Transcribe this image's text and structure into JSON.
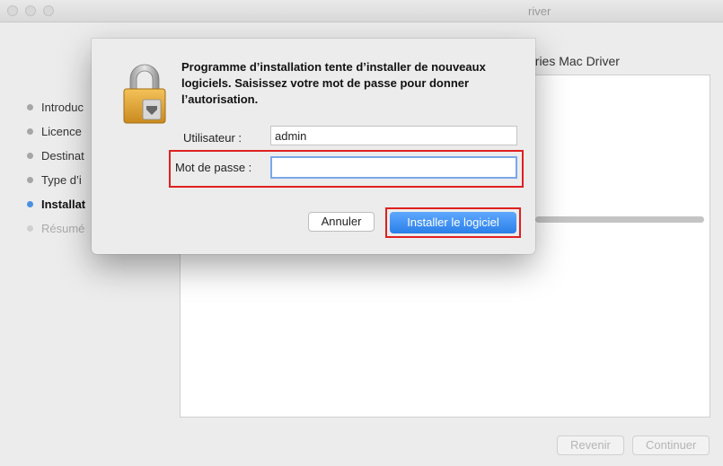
{
  "window": {
    "title_fragment": "river",
    "header_fragment": "eries Mac Driver"
  },
  "sidebar": {
    "items": [
      {
        "label": "Introduc",
        "state": "normal"
      },
      {
        "label": "Licence",
        "state": "normal"
      },
      {
        "label": "Destinat",
        "state": "normal"
      },
      {
        "label": "Type d’i",
        "state": "normal"
      },
      {
        "label": "Installat",
        "state": "active"
      },
      {
        "label": "Résumé",
        "state": "disabled"
      }
    ]
  },
  "footer": {
    "back_label": "Revenir",
    "continue_label": "Continuer"
  },
  "dialog": {
    "icon": "lock-icon",
    "message": "Programme d’installation tente d’installer de nouveaux logiciels. Saisissez votre mot de passe pour donner l’autorisation.",
    "username_label": "Utilisateur :",
    "username_value": "admin",
    "password_label": "Mot de passe :",
    "password_value": "",
    "cancel_label": "Annuler",
    "install_label": "Installer le logiciel"
  },
  "colors": {
    "highlight": "#e02020",
    "accent": "#2a7fe8",
    "active_dot": "#4a90e2"
  }
}
